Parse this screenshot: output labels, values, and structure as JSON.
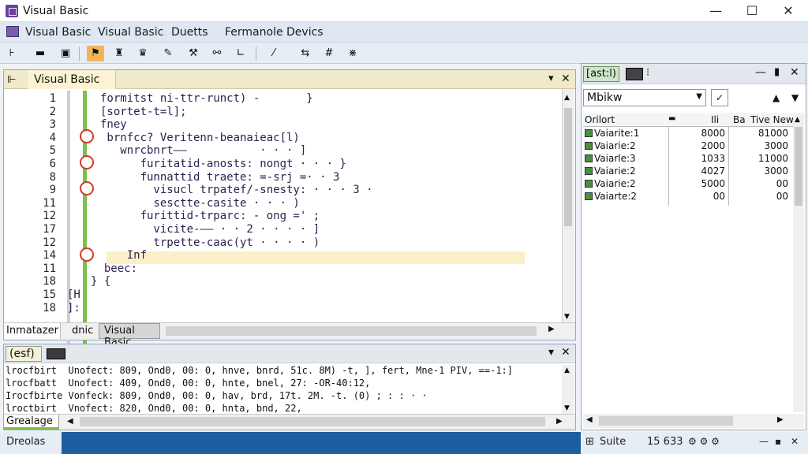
{
  "window": {
    "title": "Visual Basic",
    "minimize": "—",
    "maximize": "☐",
    "close": "✕"
  },
  "menu": [
    "Visual Basic",
    "Visual Basic",
    "Duetts",
    "Fermanole Devics"
  ],
  "editor": {
    "tab_label": "Visual Basic",
    "tab_close": "✕",
    "tab_pin": "▾",
    "line_numbers": [
      "1",
      "2",
      "3",
      "4",
      "5",
      "6",
      "8",
      "9",
      "11",
      "12",
      "17",
      "12",
      "14",
      "11",
      "18",
      "15",
      "18"
    ],
    "code_lines": [
      "formitst ni-ttr-runct) -       }",
      "[sortet-t=l];",
      "fney",
      " brnfcc? Veritenn-beanaieac[l)",
      "   wnrcbnrt——           · · · ]",
      "      furitatid-anosts: nongt · · · }",
      "      funnattid traete: =-srj =· · 3",
      "        visucl trpatef/-snesty: · · · 3 ·",
      "        sesctte-casite · · · )",
      "      furittid-trparc: - ong =' ;",
      "        vicite-—— · · 2 · · · · ]",
      "        trpette-caac(yt · · · · )",
      "    Inf",
      "  beec:",
      "} {",
      "[H",
      "]:"
    ],
    "bottom_tabs": [
      "Inmatazer",
      "dnic",
      "Visual Basic"
    ]
  },
  "right_panel": {
    "tab_label": "[ast:l)",
    "dropdown_value": "Mbikw",
    "columns": [
      "Orilort",
      "Ili",
      "Ba",
      "Tive New"
    ],
    "rows": [
      {
        "name": "Vaiarite:1",
        "v1": "8000",
        "v2": "81000"
      },
      {
        "name": "Vaiarie:2",
        "v1": "2000",
        "v2": "3000"
      },
      {
        "name": "Vaiarle:3",
        "v1": "1033",
        "v2": "11000"
      },
      {
        "name": "Vaiarie:2",
        "v1": "4027",
        "v2": "3000"
      },
      {
        "name": "Vaiarie:2",
        "v1": "5000",
        "v2": "00"
      },
      {
        "name": "Vaiarte:2",
        "v1": "00",
        "v2": "00"
      }
    ],
    "footer_label": "Suite",
    "footer_value": "15 633"
  },
  "output": {
    "tab_label": "(esf)",
    "lines": [
      "lrocfbirt  Unofect: 809, Ond0, 00: 0, hnve, bnrd, 51c. 8M) -t, ], fert, Mne-1 PIV, ==-1:]",
      "lrocfbatt  Unofect: 409, Ond0, 00: 0, hnte, bnel, 27: -OR-40:12,",
      "Irocfbirte Vonfeck: 809, Ond0, 00: 0, hav, brd, 17t. 2M. -t. (0) ; : : · ·",
      "lroctbirt  Vnofect: 820, Ond0, 00: 0, hnta, bnd, 22,"
    ],
    "bottom_tab": "Grealage"
  },
  "status": {
    "label": "Dreolas"
  },
  "colors": {
    "accent": "#6d3fa3",
    "breakpoint": "#d23a2a",
    "coverage": "#7cc04b",
    "highlight": "#fbf1c8",
    "status": "#1e5ea0"
  }
}
